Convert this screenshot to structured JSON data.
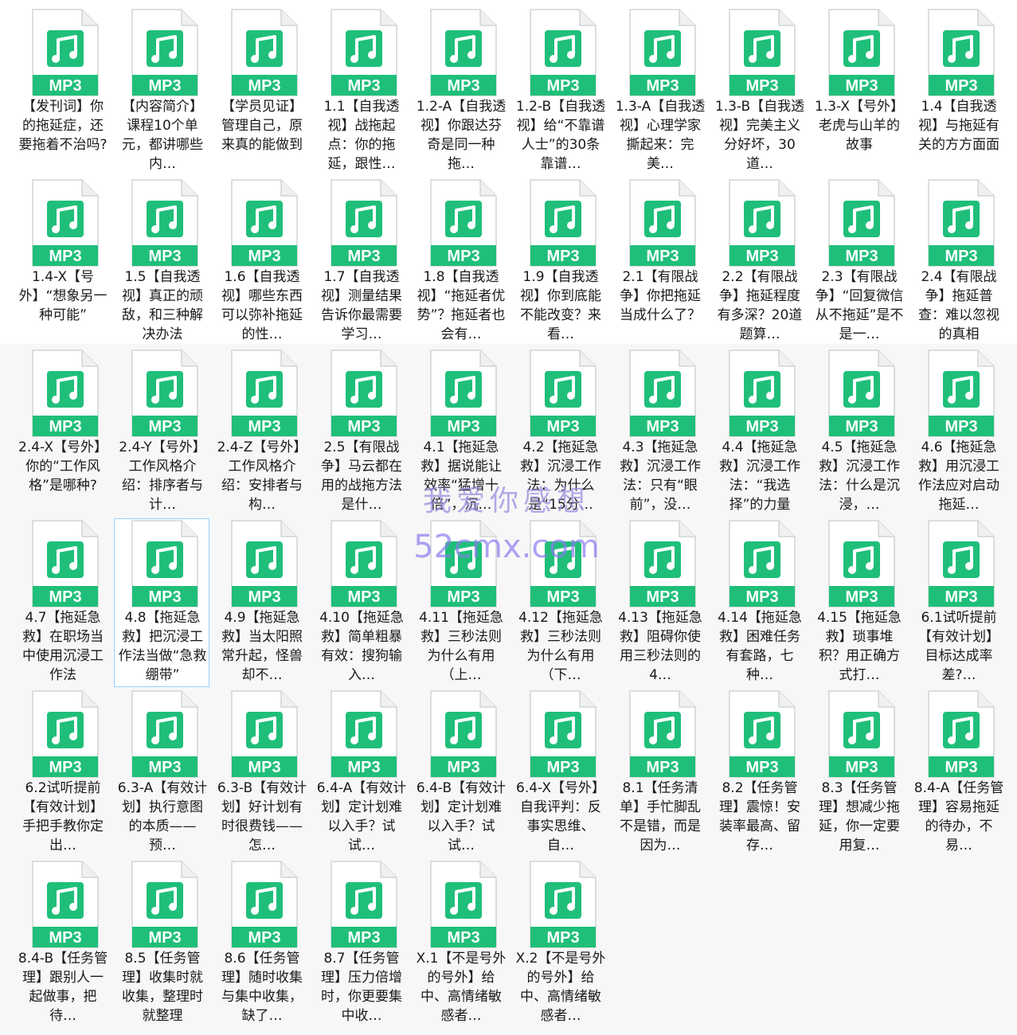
{
  "icon_badge": "MP3",
  "colors": {
    "icon_green": "#1fbf7a",
    "icon_bg": "#ffffff",
    "icon_border": "#cfd6d2"
  },
  "watermark": {
    "line1": "我爱你感想",
    "line2": "52cmx.com"
  },
  "files": [
    "【发刊词】你的拖延症，还要拖着不治吗?",
    "【内容简介】课程10个单元，都讲哪些内…",
    "【学员见证】管理自己，原来真的能做到",
    "1.1【自我透视】战拖起点：你的拖延，跟性…",
    "1.2-A【自我透视】你跟达芬奇是同一种拖…",
    "1.2-B【自我透视】给“不靠谱人士”的30条靠谱…",
    "1.3-A【自我透视】心理学家撕起来：完美…",
    "1.3-B【自我透视】完美主义分好坏，30道…",
    "1.3-X【号外】老虎与山羊的故事",
    "1.4【自我透视】与拖延有关的方方面面",
    "1.4-X【号外】“想象另一种可能”",
    "1.5【自我透视】真正的顽敌，和三种解决办法",
    "1.6【自我透视】哪些东西可以弥补拖延的性…",
    "1.7【自我透视】测量结果告诉你最需要学习…",
    "1.8【自我透视】“拖延者优势”？拖延者也会有…",
    "1.9【自我透视】你到底能不能改变？来看…",
    "2.1【有限战争】你把拖延当成什么了？",
    "2.2【有限战争】拖延程度有多深？20道题算…",
    "2.3【有限战争】“回复微信从不拖延”是不是一…",
    "2.4【有限战争】拖延普查：难以忽视的真相",
    "2.4-X【号外】你的“工作风格”是哪种?",
    "2.4-Y【号外】工作风格介绍：排序者与计…",
    "2.4-Z【号外】工作风格介绍：安排者与构…",
    "2.5【有限战争】马云都在用的战拖方法是什…",
    "4.1【拖延急救】据说能让效率“猛增十倍”，沉…",
    "4.2【拖延急救】沉浸工作法：为什么是“15分…",
    "4.3【拖延急救】沉浸工作法：只有“眼前”，没…",
    "4.4【拖延急救】沉浸工作法：“我选择”的力量",
    "4.5【拖延急救】沉浸工作法：什么是沉浸，…",
    "4.6【拖延急救】用沉浸工作法应对启动拖延…",
    "4.7【拖延急救】在职场当中使用沉浸工作法",
    "4.8【拖延急救】把沉浸工作法当做“急救绷带”",
    "4.9【拖延急救】当太阳照常升起，怪兽却不…",
    "4.10【拖延急救】简单粗暴有效：搜狗输入…",
    "4.11【拖延急救】三秒法则为什么有用（上…",
    "4.12【拖延急救】三秒法则为什么有用（下…",
    "4.13【拖延急救】阻碍你使用三秒法则的4…",
    "4.14【拖延急救】困难任务有套路，七种…",
    "4.15【拖延急救】琐事堆积？用正确方式打…",
    "6.1试听提前【有效计划】目标达成率差?…",
    "6.2试听提前【有效计划】手把手教你定出…",
    "6.3-A【有效计划】执行意图的本质——预…",
    "6.3-B【有效计划】好计划有时很费钱——怎…",
    "6.4-A【有效计划】定计划难以入手？试试…",
    "6.4-B【有效计划】定计划难以入手？试试…",
    "6.4-X【号外】自我评判：反事实思维、自…",
    "8.1【任务清单】手忙脚乱不是错，而是因为…",
    "8.2【任务管理】震惊！安装率最高、留存…",
    "8.3【任务管理】想减少拖延，你一定要用复…",
    "8.4-A【任务管理】容易拖延的待办，不易…",
    "8.4-B【任务管理】跟别人一起做事，把待…",
    "8.5【任务管理】收集时就收集，整理时就整理",
    "8.6【任务管理】随时收集与集中收集，缺了…",
    "8.7【任务管理】压力倍增时，你更要集中收…",
    "X.1【不是号外的号外】给中、高情绪敏感者…",
    "X.2【不是号外的号外】给中、高情绪敏感者…"
  ]
}
